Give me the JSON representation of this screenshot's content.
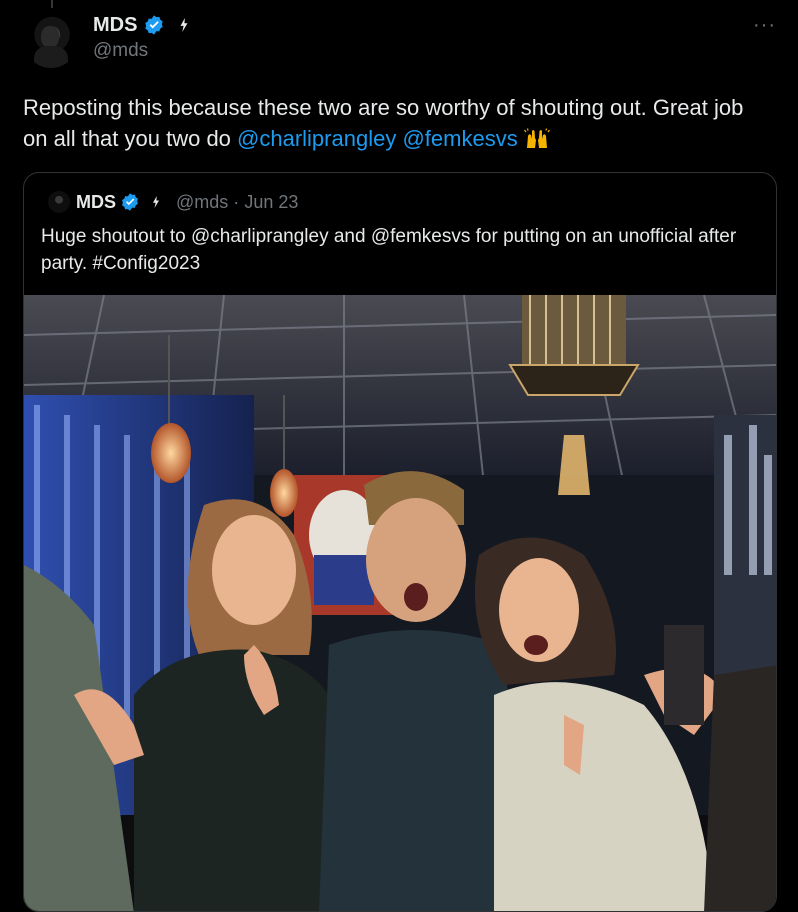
{
  "post": {
    "author_name": "MDS",
    "author_handle": "@mds",
    "more_label": "···",
    "text_lead": "Reposting this because these two are so worthy of shouting out. Great job on all that you two do ",
    "mention_1": "@charliprangley",
    "mention_2": "@femkesvs",
    "emoji_name": "raising-hands-icon"
  },
  "quoted_post": {
    "author_name": "MDS",
    "author_handle": "@mds",
    "separator": "·",
    "date": "Jun 23",
    "text": "Huge shoutout to @charliprangley and @femkesvs for putting on an unofficial after party. #Config2023"
  },
  "colors": {
    "background": "#000000",
    "text": "#e7e9ea",
    "muted": "#71767b",
    "link": "#1d9bf0",
    "verified": "#1d9bf0",
    "border": "#2f3336"
  }
}
